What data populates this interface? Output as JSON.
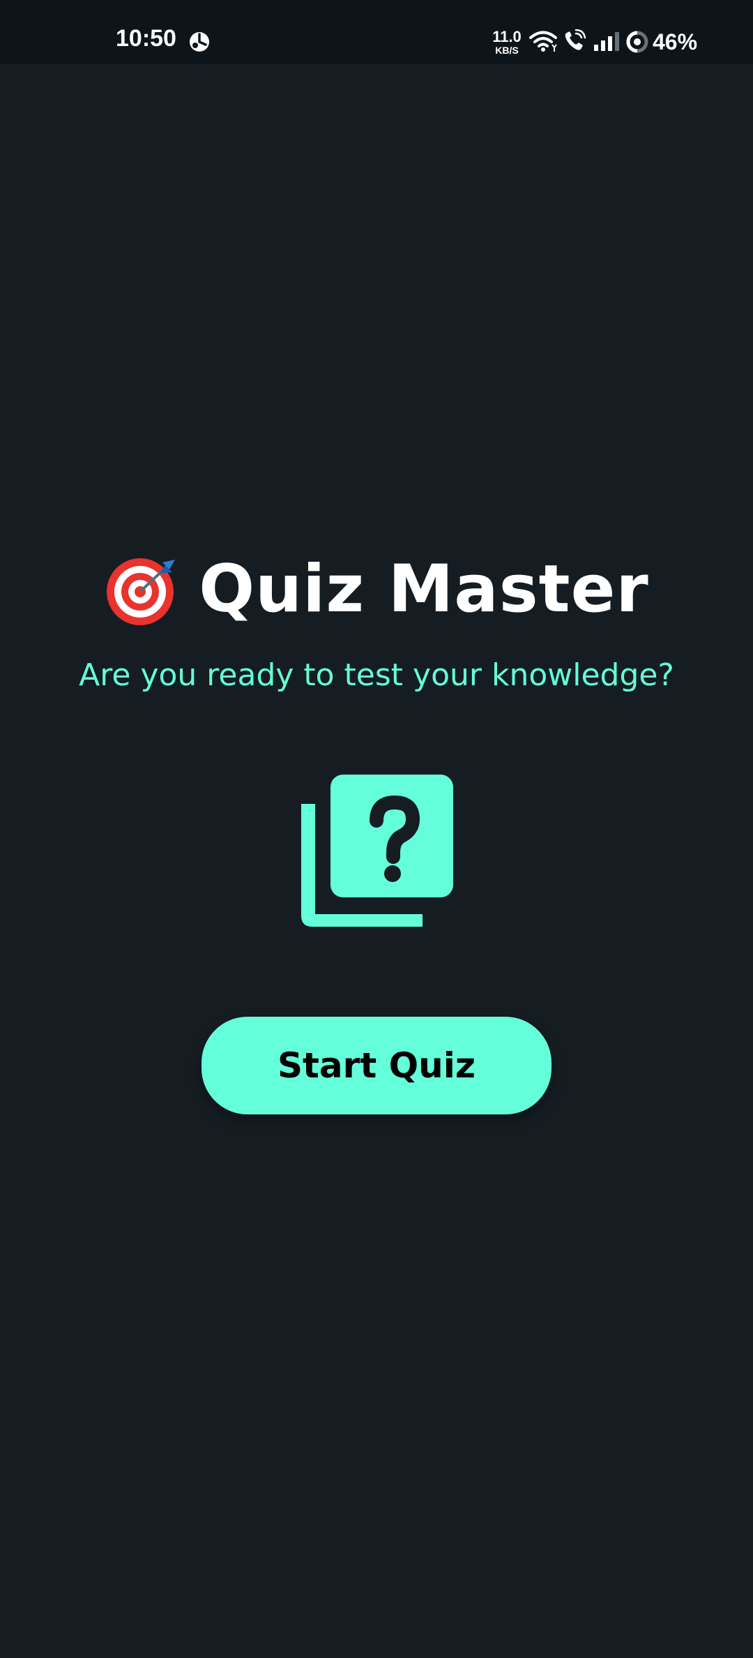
{
  "status_bar": {
    "time": "10:50",
    "network_speed_value": "11.0",
    "network_speed_unit": "KB/S",
    "battery_percent": "46%",
    "icons": [
      "app-notification-icon",
      "wifi-icon",
      "wifi-call-icon",
      "signal-icon",
      "battery-ring-icon"
    ]
  },
  "main": {
    "title_emoji": "target-dart-icon",
    "title": "Quiz Master",
    "subtitle": "Are you ready to test your knowledge?",
    "illustration": "quiz-question-icon",
    "start_button_label": "Start Quiz"
  },
  "colors": {
    "background": "#151D23",
    "status_bar": "#0E151A",
    "accent": "#64FFDA",
    "title": "#FFFFFF",
    "button_text": "#000000"
  }
}
